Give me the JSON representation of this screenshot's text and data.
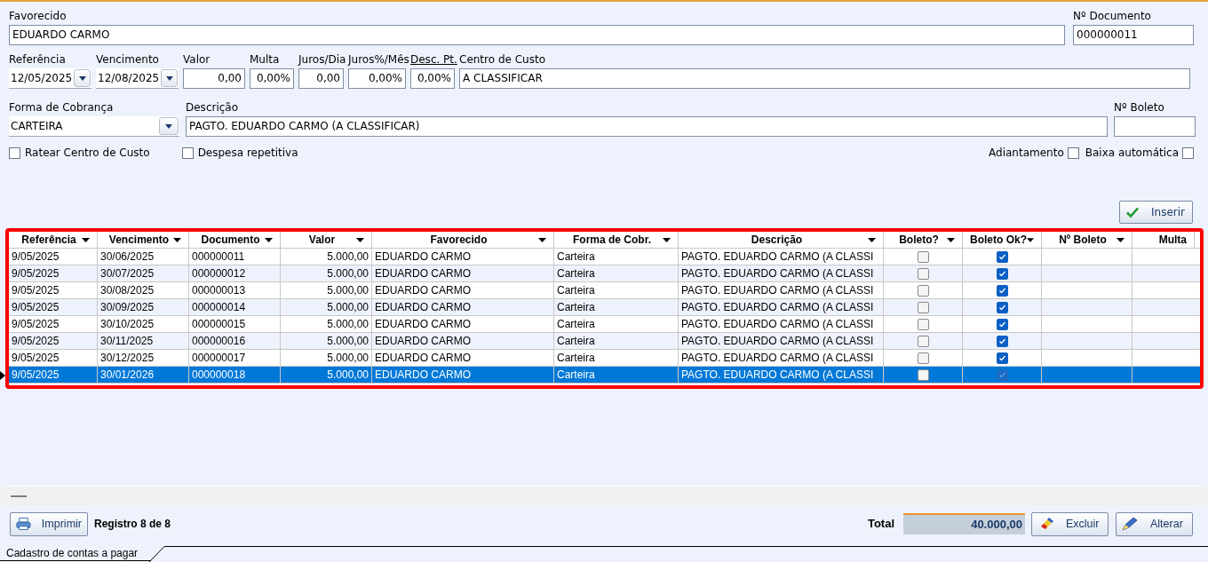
{
  "form": {
    "rows": [
      {
        "fields": [
          {
            "label": "Favorecido",
            "underlined": false,
            "value": "EDUARDO CARMO",
            "kind": "text"
          },
          {
            "label": "Nº Documento",
            "underlined": false,
            "value": "000000011",
            "kind": "text"
          }
        ]
      },
      {
        "fields": [
          {
            "label": "Referência",
            "underlined": false,
            "value": "12/05/2025",
            "kind": "dropdown"
          },
          {
            "label": "Vencimento",
            "underlined": false,
            "value": "12/08/2025",
            "kind": "dropdown"
          },
          {
            "label": "Valor",
            "underlined": false,
            "value": "0,00",
            "kind": "number"
          },
          {
            "label": "Multa",
            "underlined": false,
            "value": "0,00%",
            "kind": "number"
          },
          {
            "label": "Juros/Dia",
            "underlined": false,
            "value": "0,00",
            "kind": "number"
          },
          {
            "label": "Juros%/Mês",
            "underlined": false,
            "value": "0,00%",
            "kind": "number"
          },
          {
            "label": "Desc. Pt.",
            "underlined": true,
            "value": "0,00%",
            "kind": "number"
          },
          {
            "label": "Centro de Custo",
            "underlined": false,
            "value": "A CLASSIFICAR",
            "kind": "text"
          }
        ]
      },
      {
        "fields": [
          {
            "label": "Forma de Cobrança",
            "underlined": false,
            "value": "CARTEIRA",
            "kind": "dropdown"
          },
          {
            "label": "Descrição",
            "underlined": false,
            "value": "PAGTO. EDUARDO CARMO (A CLASSIFICAR)",
            "kind": "text"
          },
          {
            "label": "Nº Boleto",
            "underlined": false,
            "kind": "text"
          }
        ]
      }
    ],
    "left_checks": [
      {
        "label": "Ratear Centro de Custo",
        "checked": false
      },
      {
        "label": "Despesa repetitiva",
        "checked": false
      }
    ],
    "right_checks": [
      {
        "label": "Adiantamento",
        "checked": false
      },
      {
        "label": "Baixa automática",
        "checked": false
      }
    ],
    "insert_button": "Inserir"
  },
  "table": {
    "columns": [
      {
        "label": "Referência",
        "sort": true
      },
      {
        "label": "Vencimento",
        "sort": true
      },
      {
        "label": "Documento",
        "sort": true
      },
      {
        "label": "Valor",
        "sort": true
      },
      {
        "label": "Favorecido",
        "sort": true
      },
      {
        "label": "Forma de Cobr.",
        "sort": true
      },
      {
        "label": "Descrição",
        "sort": true
      },
      {
        "label": "Boleto?",
        "sort": true
      },
      {
        "label": "Boleto Ok?",
        "sort": true
      },
      {
        "label": "Nº Boleto",
        "sort": true
      },
      {
        "label": "Multa",
        "sort": false
      }
    ],
    "rows": [
      {
        "selected": false,
        "cells": [
          "9/05/2025",
          "30/06/2025",
          "000000011",
          "5.000,00",
          "EDUARDO CARMO",
          "Carteira",
          "PAGTO. EDUARDO CARMO (A CLASSI"
        ],
        "boleto": false,
        "boleto_ok": true
      },
      {
        "selected": false,
        "cells": [
          "9/05/2025",
          "30/07/2025",
          "000000012",
          "5.000,00",
          "EDUARDO CARMO",
          "Carteira",
          "PAGTO. EDUARDO CARMO (A CLASSI"
        ],
        "boleto": false,
        "boleto_ok": true
      },
      {
        "selected": false,
        "cells": [
          "9/05/2025",
          "30/08/2025",
          "000000013",
          "5.000,00",
          "EDUARDO CARMO",
          "Carteira",
          "PAGTO. EDUARDO CARMO (A CLASSI"
        ],
        "boleto": false,
        "boleto_ok": true
      },
      {
        "selected": false,
        "cells": [
          "9/05/2025",
          "30/09/2025",
          "000000014",
          "5.000,00",
          "EDUARDO CARMO",
          "Carteira",
          "PAGTO. EDUARDO CARMO (A CLASSI"
        ],
        "boleto": false,
        "boleto_ok": true
      },
      {
        "selected": false,
        "cells": [
          "9/05/2025",
          "30/10/2025",
          "000000015",
          "5.000,00",
          "EDUARDO CARMO",
          "Carteira",
          "PAGTO. EDUARDO CARMO (A CLASSI"
        ],
        "boleto": false,
        "boleto_ok": true
      },
      {
        "selected": false,
        "cells": [
          "9/05/2025",
          "30/11/2025",
          "000000016",
          "5.000,00",
          "EDUARDO CARMO",
          "Carteira",
          "PAGTO. EDUARDO CARMO (A CLASSI"
        ],
        "boleto": false,
        "boleto_ok": true
      },
      {
        "selected": false,
        "cells": [
          "9/05/2025",
          "30/12/2025",
          "000000017",
          "5.000,00",
          "EDUARDO CARMO",
          "Carteira",
          "PAGTO. EDUARDO CARMO (A CLASSI"
        ],
        "boleto": false,
        "boleto_ok": true
      },
      {
        "selected": true,
        "cells": [
          "9/05/2025",
          "30/01/2026",
          "000000018",
          "5.000,00",
          "EDUARDO CARMO",
          "Carteira",
          "PAGTO. EDUARDO CARMO (A CLASSI"
        ],
        "boleto": false,
        "boleto_ok": true
      }
    ]
  },
  "footer": {
    "print_button": "Imprimir",
    "record": "Registro 8 de 8",
    "total_label": "Total",
    "total_value": "40.000,00",
    "delete_button": "Excluir",
    "edit_button": "Alterar"
  },
  "tab": {
    "label": "Cadastro de contas a pagar"
  }
}
